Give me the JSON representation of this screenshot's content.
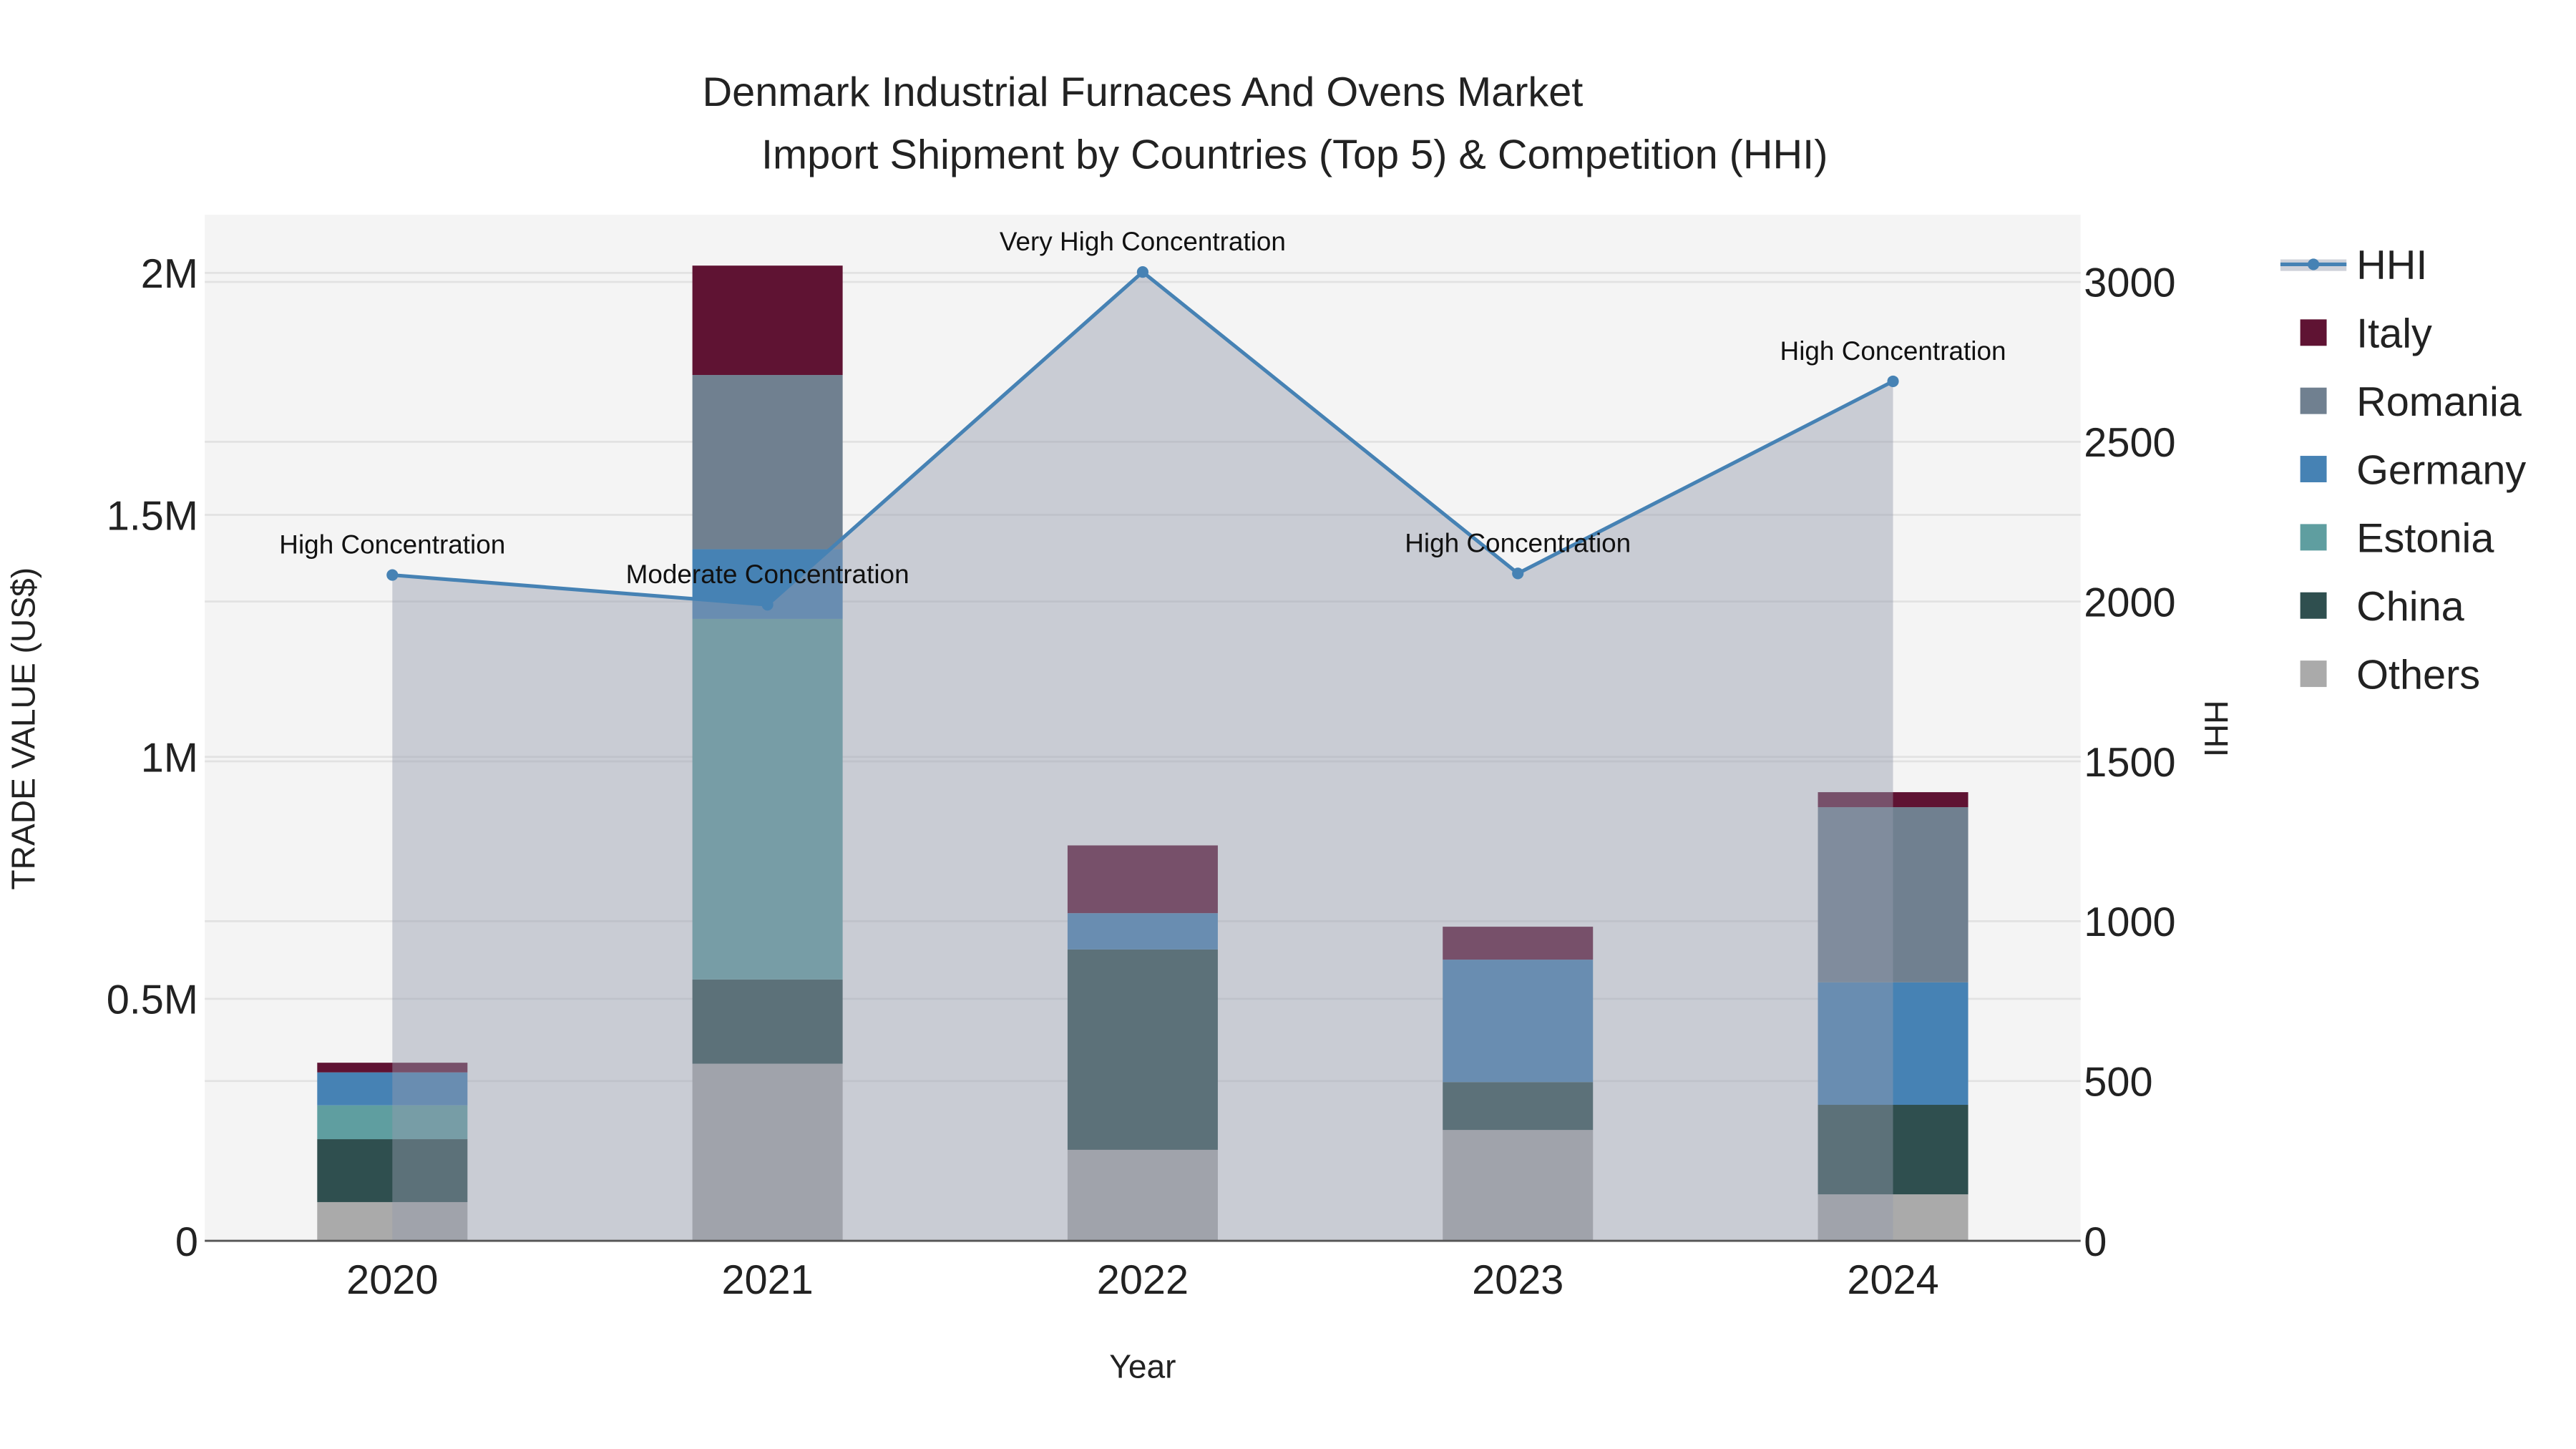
{
  "chart_data": {
    "type": "bar",
    "title": "Denmark Industrial Furnaces And Ovens Market",
    "subtitle": "Import Shipment by Countries (Top 5) & Competition (HHI)",
    "xlabel": "Year",
    "ylabel": "TRADE VALUE (US$)",
    "y2label": "HHI",
    "categories": [
      "2020",
      "2021",
      "2022",
      "2023",
      "2024"
    ],
    "ylim": [
      0,
      2120000
    ],
    "y2lim": [
      0,
      3210
    ],
    "yticks": [
      {
        "v": 0,
        "label": "0"
      },
      {
        "v": 500000,
        "label": "0.5M"
      },
      {
        "v": 1000000,
        "label": "1M"
      },
      {
        "v": 1500000,
        "label": "1.5M"
      },
      {
        "v": 2000000,
        "label": "2M"
      }
    ],
    "y2ticks": [
      0,
      500,
      1000,
      1500,
      2000,
      2500,
      3000
    ],
    "grid": true,
    "legend_position": "right",
    "stacked": true,
    "series": [
      {
        "name": "Others",
        "color": "#aaaaaa",
        "values": [
          80000,
          366000,
          188000,
          229000,
          96000
        ]
      },
      {
        "name": "China",
        "color": "#2f4f4f",
        "values": [
          130000,
          174000,
          414000,
          99000,
          185000
        ]
      },
      {
        "name": "Estonia",
        "color": "#5f9ea0",
        "values": [
          70000,
          745000,
          0,
          0,
          0
        ]
      },
      {
        "name": "Germany",
        "color": "#4682b4",
        "values": [
          68000,
          144000,
          75000,
          253000,
          253000
        ]
      },
      {
        "name": "Romania",
        "color": "#708090",
        "values": [
          0,
          360000,
          0,
          0,
          362000
        ]
      },
      {
        "name": "Italy",
        "color": "#5f1333",
        "values": [
          20000,
          226000,
          140000,
          68000,
          31000
        ]
      }
    ],
    "hhi": {
      "name": "HHI",
      "color": "#4682b4",
      "values": [
        2083,
        1990,
        3031,
        2088,
        2689
      ],
      "labels": [
        "High Concentration",
        "Moderate Concentration",
        "Very High Concentration",
        "High Concentration",
        "High Concentration"
      ]
    },
    "legend": [
      "HHI",
      "Italy",
      "Romania",
      "Germany",
      "Estonia",
      "China",
      "Others"
    ]
  }
}
